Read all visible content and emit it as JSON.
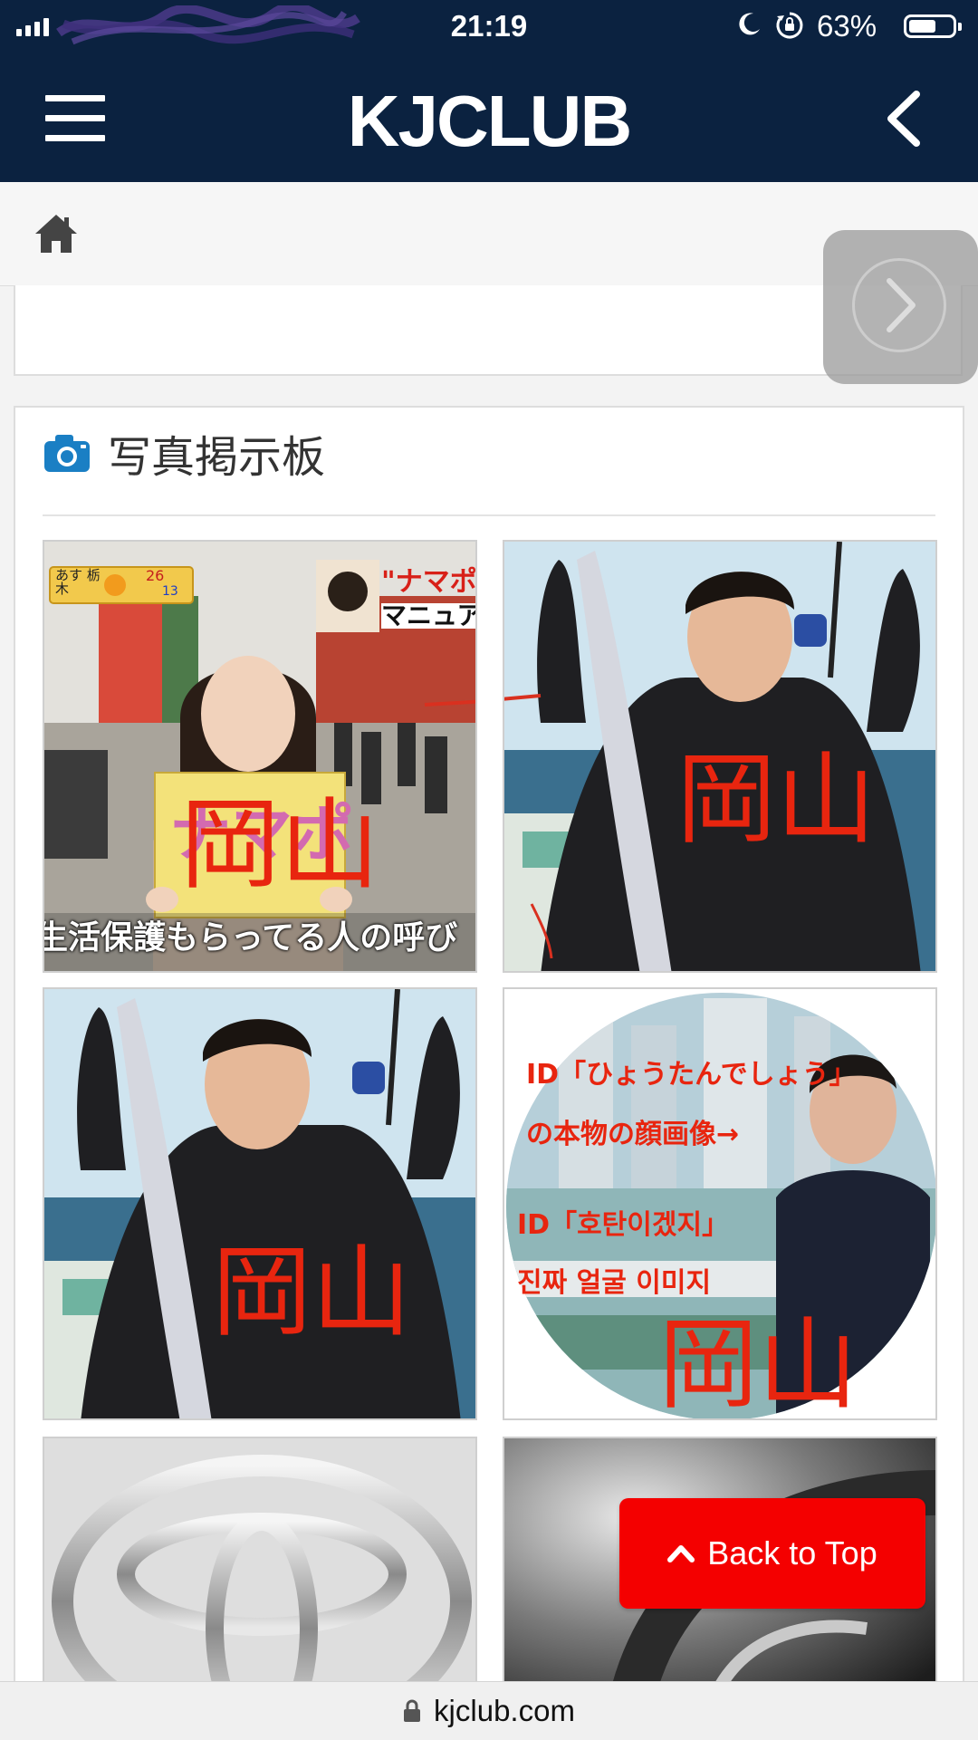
{
  "status_bar": {
    "time": "21:19",
    "battery_percent": "63%",
    "battery_level": 0.63,
    "icons": [
      "signal-icon",
      "moon-icon",
      "rotation-lock-icon",
      "battery-icon"
    ]
  },
  "navbar": {
    "logo": "KJCLUB",
    "background_color": "#0b2240",
    "icons": [
      "hamburger-menu-icon",
      "back-chevron-icon"
    ]
  },
  "breadcrumb": {
    "icon": "home-icon"
  },
  "photo_board": {
    "title": "写真掲示板",
    "icon": "camera-icon",
    "accent_color": "#1a7fc4",
    "thumbnails": [
      {
        "signboard_text": "ナマポ",
        "caption": "生活保護もらってる人の呼び",
        "weather_label": "あす 栃木",
        "weather_temp": "26",
        "weather_low": "13",
        "inset_title": "\"ナマポ\"も",
        "inset_subtitle": "マニュアル",
        "annotation": "岡山"
      },
      {
        "annotation": "岡山"
      },
      {
        "annotation": "岡山"
      },
      {
        "lines": [
          "ID「ひょうたんでしょう」",
          "の本物の顔画像→",
          "ID「호탄이겠지」",
          "진짜 얼굴 이미지"
        ],
        "annotation": "岡山"
      },
      {},
      {}
    ]
  },
  "back_to_top": {
    "label": "Back to Top",
    "color": "#f40000"
  },
  "url_bar": {
    "url": "kjclub.com"
  }
}
